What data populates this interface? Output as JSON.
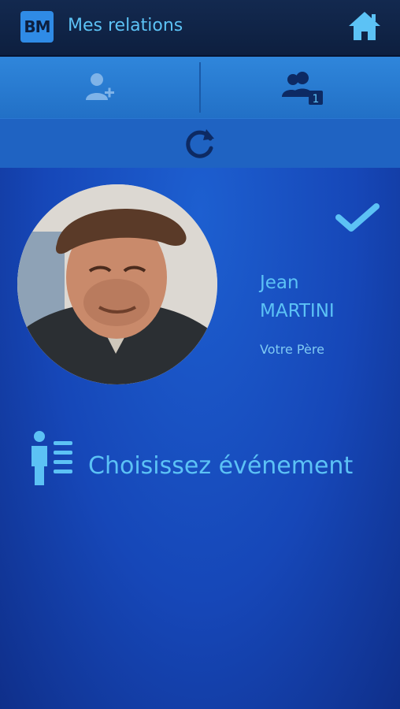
{
  "header": {
    "logo_text": "BM",
    "title": "Mes relations"
  },
  "tabs": {
    "group_badge": "1"
  },
  "contact": {
    "first_name": "Jean",
    "last_name": "MARTINI",
    "relation": "Votre Père"
  },
  "event": {
    "label": "Choisissez événement"
  },
  "colors": {
    "accent": "#5cc2f5",
    "header_bg": "#0d1f3f",
    "background": "#1647b8"
  },
  "icons": [
    "home-icon",
    "add-contact-icon",
    "group-icon",
    "refresh-icon",
    "check-icon",
    "event-list-icon"
  ]
}
